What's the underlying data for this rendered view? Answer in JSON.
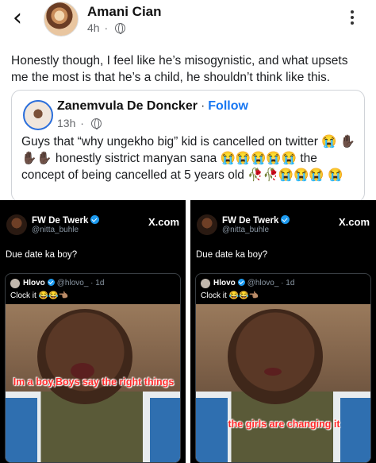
{
  "header": {
    "back_icon": "chevron-left-icon",
    "author": "Amani Cian",
    "time": "4h",
    "audience_icon": "globe-icon",
    "more_icon": "ellipsis-vertical-icon"
  },
  "post": {
    "text": "Honestly though, I feel like he’s misogynistic, and what upsets me the most is that he’s a child, he shouldn’t think like this."
  },
  "shared_post": {
    "author": "Zanemvula De Doncker",
    "follow_label": "Follow",
    "time": "13h",
    "text": "Guys that “why ungekho big” kid is cancelled on twitter 😭 ✋🏿✋🏿✋🏿 honestly sistrict manyan sana 😭😭😭😭😭 the concept of being cancelled at 5 years old 🥀🥀😭😭😭 😭"
  },
  "screenshots": [
    {
      "name": "FW De Twerk",
      "handle": "@nitta_buhle",
      "site": "X.com",
      "text": "Due date ka boy?",
      "quote_name": "Hlovo",
      "quote_handle": "@hlovo_ · 1d",
      "quote_text": "Clock it 😂😂👈🏽",
      "caption": "Im a boy,Boys say the right things"
    },
    {
      "name": "FW De Twerk",
      "handle": "@nitta_buhle",
      "site": "X.com",
      "text": "Due date ka boy?",
      "quote_name": "Hlovo",
      "quote_handle": "@hlovo_ · 1d",
      "quote_text": "Clock it 😂😂👈🏽",
      "caption": "the girls are changing it"
    }
  ]
}
